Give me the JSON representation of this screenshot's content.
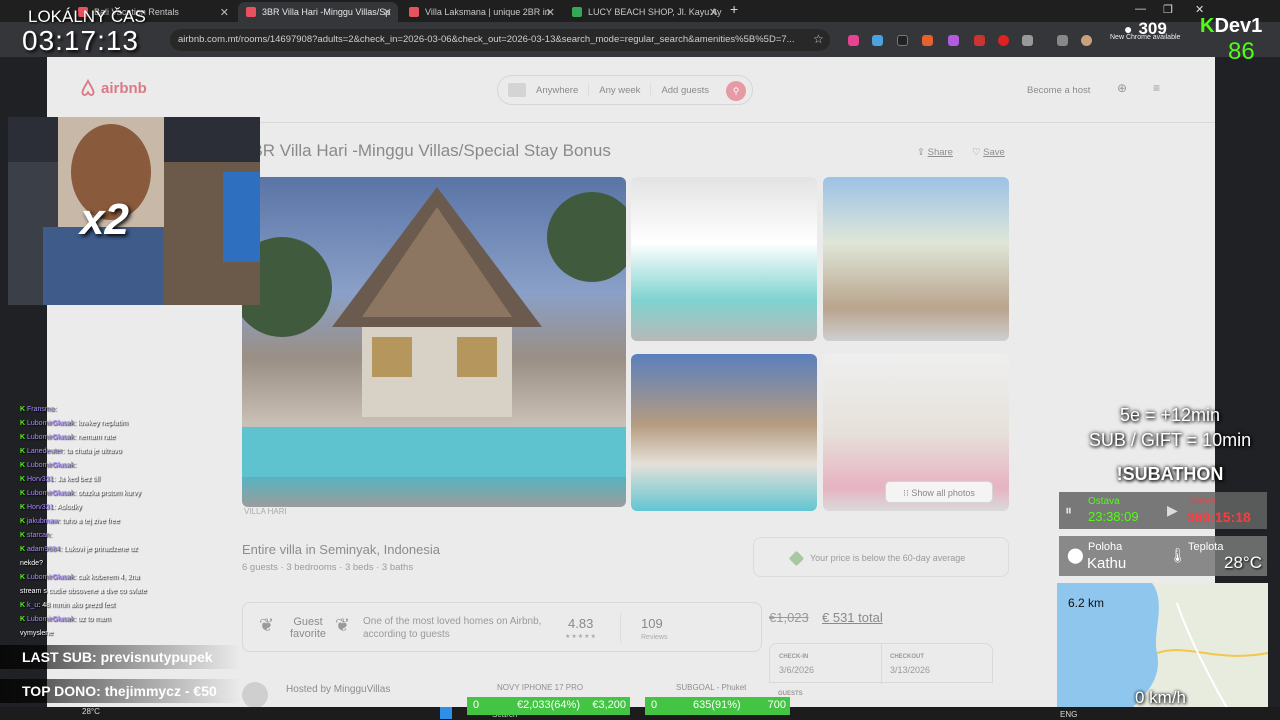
{
  "browser": {
    "tabs": [
      {
        "label": "Bali Vacation Rentals",
        "color": "#e8525f"
      },
      {
        "label": "3BR Villa Hari -Minggu Villas/Sp",
        "color": "#e8525f"
      },
      {
        "label": "Villa Laksmana | unique 2BR in",
        "color": "#e8525f"
      },
      {
        "label": "LUCY BEACH SHOP, Jl. Kayu Ay",
        "color": "#35a853"
      }
    ],
    "new_tab": "+",
    "url": "airbnb.com.mt/rooms/14697908?adults=2&check_in=2026-03-06&check_out=2026-03-13&search_mode=regular_search&amenities%5B%5D=7...",
    "update_notice": "New Chrome available"
  },
  "airbnb": {
    "logo": "airbnb",
    "search": {
      "where": "Anywhere",
      "when": "Any week",
      "who": "Add guests"
    },
    "become_host": "Become a host",
    "title": "3BR Villa Hari -Minggu Villas/Special Stay Bonus",
    "share": "Share",
    "save": "Save",
    "show_all_photos": "Show all photos",
    "photo_caption": "VILLA HARI",
    "subtitle": "Entire villa in Seminyak, Indonesia",
    "details": "6 guests · 3 bedrooms · 3 beds · 3 baths",
    "guest_favorite": "Guest favorite",
    "loved_text": "One of the most loved homes on Airbnb, according to guests",
    "rating": "4.83",
    "stars": "★★★★★",
    "reviews_count": "109",
    "reviews_label": "Reviews",
    "hosted_by": "Hosted by MingguVillas",
    "price_note": "Your price is below the 60-day average",
    "old_price": "€1,023",
    "total_price": "€ 531 total",
    "checkin_label": "CHECK-IN",
    "checkin_value": "3/6/2026",
    "checkout_label": "CHECKOUT",
    "checkout_value": "3/13/2026",
    "guests_label": "GUESTS"
  },
  "stream": {
    "local_time_label": "LOKÁLNY ČAS",
    "local_time": "03:17:13",
    "viewers": "309",
    "channel_k": "K",
    "channel_name": "Dev1",
    "channel_num": "86",
    "multiplier": "x2",
    "chat": [
      {
        "user": "Fransmo",
        "msg": ""
      },
      {
        "user": "LubomirGlusak",
        "msg": "lowkey neplatim"
      },
      {
        "user": "LubomirGlusak",
        "msg": "nemam rate"
      },
      {
        "user": "Lanedeuter",
        "msg": "ta chata je ultravo"
      },
      {
        "user": "LubomirGlusak",
        "msg": ""
      },
      {
        "user": "Horv331",
        "msg": "Ja ked bez till"
      },
      {
        "user": "LubomirGlusak",
        "msg": "otazka prstom kurvy"
      },
      {
        "user": "Horv331",
        "msg": "Aslodky"
      },
      {
        "user": "jakubmaw",
        "msg": "tuho a tej zive free"
      },
      {
        "user": "starcan",
        "msg": ""
      },
      {
        "user": "adam9684",
        "msg": "Lukovi je prinadzene uz"
      },
      {
        "user": "",
        "msg": "nekde?"
      },
      {
        "user": "LubomirGlusak",
        "msg": "cak koberem 4, 2na"
      },
      {
        "user": "",
        "msg": "stream s cudie obsovene a dve co svlate"
      },
      {
        "user": "k_u",
        "msg": "48 mmin ako prezd fest"
      },
      {
        "user": "LubomirGlusak",
        "msg": "uz to mam"
      },
      {
        "user": "",
        "msg": "vymyslene"
      }
    ],
    "last_sub_label": "LAST SUB:",
    "last_sub_name": "previsnutypupek",
    "top_dono_label": "TOP DONO:",
    "top_dono_name": "thejimmycz - €50",
    "rule1": "5e = +12min",
    "rule2": "SUB / GIFT = 10min",
    "rule3": "!SUBATHON",
    "ostava_label": "Ostava",
    "ostava_value": "23:38:09",
    "ideme_label": "Ideme",
    "ideme_value": "369:15:18",
    "poloha_label": "Poloha",
    "poloha_value": "Kathu",
    "teplota_label": "Teplota",
    "teplota_value": "28°C",
    "distance": "6.2 km",
    "speed": "0 km/h",
    "goal1_label": "NOVY IPHONE 17 PRO",
    "goal1_count": "0",
    "goal1_amount": "€2,033(64%)",
    "goal1_target": "€3,200",
    "goal2_label": "SUBGOAL - Phuket",
    "goal2_count": "0",
    "goal2_amount": "635(91%)",
    "goal2_target": "700",
    "taskbar_temp": "28°C",
    "taskbar_search": "Search",
    "taskbar_lang": "ENG"
  }
}
